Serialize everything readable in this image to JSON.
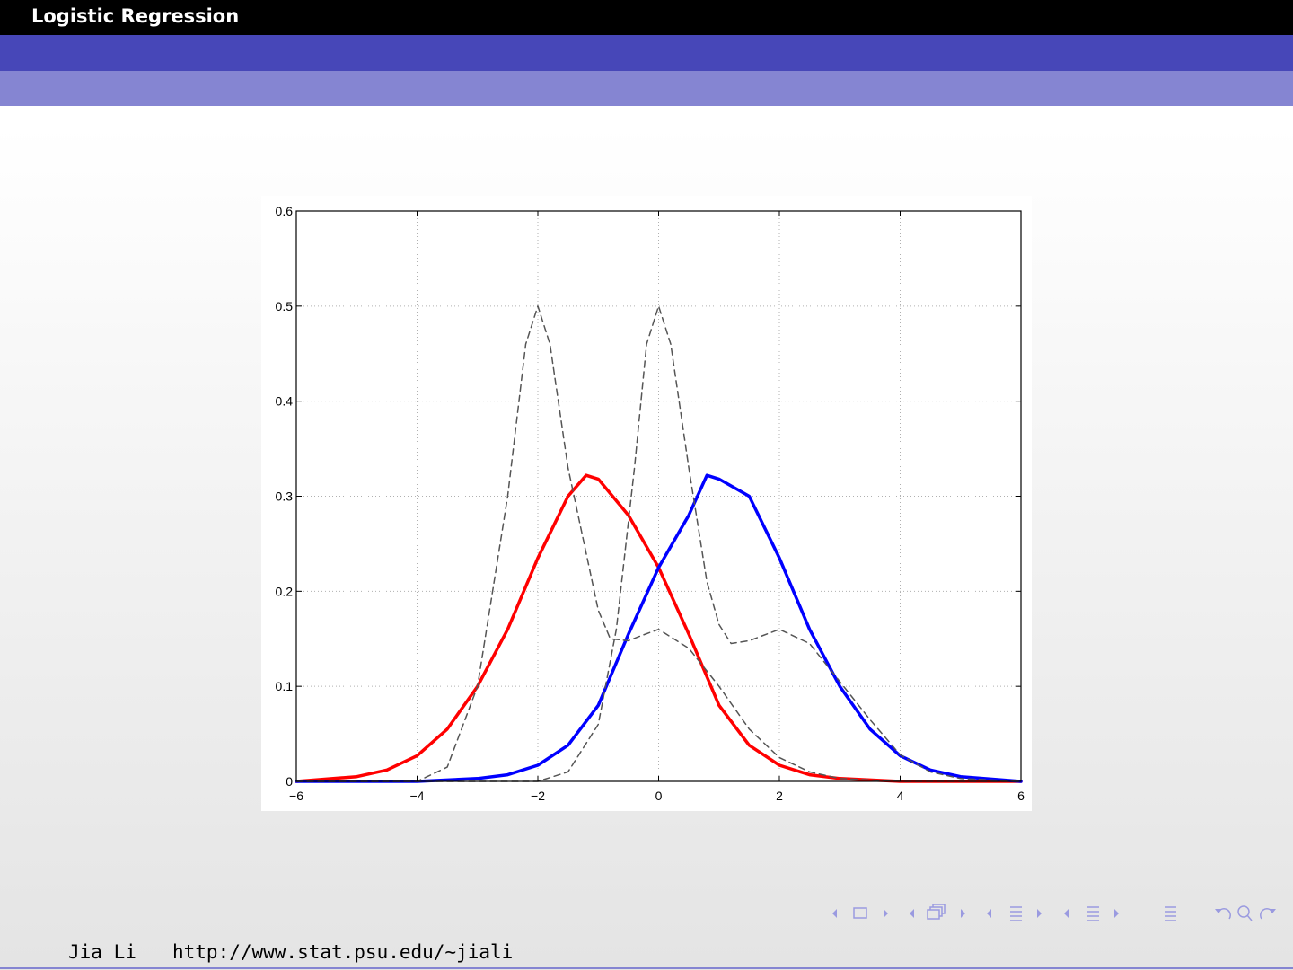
{
  "slide": {
    "header_title": "Logistic Regression",
    "author": "Jia Li",
    "url": "http://www.stat.psu.edu/∼jiali"
  },
  "nav": {
    "icons": [
      "nav-frame-prev-icon",
      "nav-frame-icon",
      "nav-frame-next-icon",
      "nav-subsection-prev-icon",
      "nav-subsection-icon",
      "nav-subsection-next-icon",
      "nav-section-prev-icon",
      "nav-section-icon",
      "nav-section-next-icon",
      "nav-slide-prev-icon",
      "nav-slide-icon",
      "nav-slide-next-icon",
      "nav-align-icon",
      "nav-undo-icon",
      "nav-search-icon",
      "nav-redo-icon"
    ]
  },
  "colors": {
    "header_black": "#000000",
    "header_blue": "#4747b8",
    "header_light": "#8585d2",
    "red_series": "#ff0000",
    "blue_series": "#0000ff",
    "dashed_series": "#555555"
  },
  "chart_data": {
    "type": "line",
    "title": "",
    "xlabel": "",
    "ylabel": "",
    "xlim": [
      -6,
      6
    ],
    "ylim": [
      0,
      0.6
    ],
    "xticks": [
      "−6",
      "−4",
      "−2",
      "0",
      "2",
      "4",
      "6"
    ],
    "yticks": [
      "0",
      "0.1",
      "0.2",
      "0.3",
      "0.4",
      "0.5",
      "0.6"
    ],
    "grid": true,
    "legend": "none",
    "series": [
      {
        "style": "solid",
        "color": "#ff0000",
        "points": [
          [
            -6,
            0.0
          ],
          [
            -5,
            0.005
          ],
          [
            -4.5,
            0.012
          ],
          [
            -4,
            0.027
          ],
          [
            -3.5,
            0.055
          ],
          [
            -3,
            0.1
          ],
          [
            -2.5,
            0.16
          ],
          [
            -2,
            0.235
          ],
          [
            -1.5,
            0.3
          ],
          [
            -1.2,
            0.322
          ],
          [
            -1,
            0.318
          ],
          [
            -0.5,
            0.28
          ],
          [
            0,
            0.225
          ],
          [
            0.5,
            0.155
          ],
          [
            1,
            0.08
          ],
          [
            1.5,
            0.038
          ],
          [
            2,
            0.017
          ],
          [
            2.5,
            0.007
          ],
          [
            3,
            0.003
          ],
          [
            4,
            0.0
          ],
          [
            5,
            0.0
          ],
          [
            6,
            0.0
          ]
        ]
      },
      {
        "style": "solid",
        "color": "#0000ff",
        "points": [
          [
            -6,
            0.0
          ],
          [
            -5,
            0.0
          ],
          [
            -4,
            0.0
          ],
          [
            -3,
            0.003
          ],
          [
            -2.5,
            0.007
          ],
          [
            -2,
            0.017
          ],
          [
            -1.5,
            0.038
          ],
          [
            -1,
            0.08
          ],
          [
            -0.5,
            0.155
          ],
          [
            0,
            0.225
          ],
          [
            0.5,
            0.28
          ],
          [
            0.8,
            0.322
          ],
          [
            1,
            0.318
          ],
          [
            1.5,
            0.3
          ],
          [
            2,
            0.235
          ],
          [
            2.5,
            0.16
          ],
          [
            3,
            0.1
          ],
          [
            3.5,
            0.055
          ],
          [
            4,
            0.027
          ],
          [
            4.5,
            0.012
          ],
          [
            5,
            0.005
          ],
          [
            6,
            0.0
          ]
        ]
      },
      {
        "style": "dashed",
        "color": "#555555",
        "points": [
          [
            -6,
            0.0
          ],
          [
            -4,
            0.0
          ],
          [
            -3.5,
            0.015
          ],
          [
            -3,
            0.1
          ],
          [
            -2.5,
            0.3
          ],
          [
            -2.2,
            0.46
          ],
          [
            -2,
            0.5
          ],
          [
            -1.8,
            0.46
          ],
          [
            -1.5,
            0.33
          ],
          [
            -1,
            0.18
          ],
          [
            -0.8,
            0.15
          ],
          [
            -0.5,
            0.148
          ],
          [
            -0.3,
            0.153
          ],
          [
            0,
            0.16
          ],
          [
            0.5,
            0.14
          ],
          [
            1,
            0.1
          ],
          [
            1.5,
            0.055
          ],
          [
            2,
            0.025
          ],
          [
            2.5,
            0.01
          ],
          [
            3,
            0.003
          ],
          [
            4,
            0.0
          ],
          [
            6,
            0.0
          ]
        ]
      },
      {
        "style": "dashed",
        "color": "#555555",
        "points": [
          [
            -6,
            0.0
          ],
          [
            -2,
            0.0
          ],
          [
            -1.5,
            0.01
          ],
          [
            -1,
            0.06
          ],
          [
            -0.7,
            0.16
          ],
          [
            -0.4,
            0.33
          ],
          [
            -0.2,
            0.46
          ],
          [
            0,
            0.5
          ],
          [
            0.2,
            0.46
          ],
          [
            0.5,
            0.33
          ],
          [
            0.8,
            0.21
          ],
          [
            1,
            0.165
          ],
          [
            1.2,
            0.145
          ],
          [
            1.5,
            0.148
          ],
          [
            2,
            0.16
          ],
          [
            2.5,
            0.145
          ],
          [
            3,
            0.105
          ],
          [
            3.5,
            0.065
          ],
          [
            4,
            0.028
          ],
          [
            4.5,
            0.01
          ],
          [
            5,
            0.003
          ],
          [
            6,
            0.0
          ]
        ]
      }
    ]
  }
}
